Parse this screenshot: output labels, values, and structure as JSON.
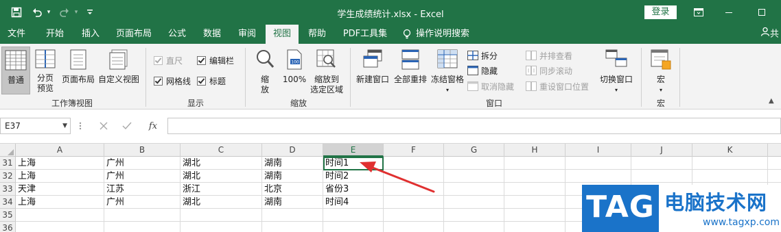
{
  "titlebar": {
    "title": "学生成绩统计.xlsx  -  Excel",
    "login_label": "登录",
    "bg_color": "#217346"
  },
  "tabs": [
    {
      "label": "文件"
    },
    {
      "label": "开始"
    },
    {
      "label": "插入"
    },
    {
      "label": "页面布局"
    },
    {
      "label": "公式"
    },
    {
      "label": "数据"
    },
    {
      "label": "审阅"
    },
    {
      "label": "视图"
    },
    {
      "label": "帮助"
    },
    {
      "label": "PDF工具集"
    },
    {
      "label": "操作说明搜索"
    }
  ],
  "active_tab": "视图",
  "tab_share_fragment": "共",
  "ribbon": {
    "workbook_views": {
      "group_label": "工作簿视图",
      "normal": "普通",
      "page_break_line1": "分页",
      "page_break_line2": "预览",
      "page_layout": "页面布局",
      "custom_view": "自定义视图"
    },
    "show": {
      "group_label": "显示",
      "ruler": "直尺",
      "formula_bar": "编辑栏",
      "gridlines": "网格线",
      "headings": "标题"
    },
    "zoom": {
      "group_label": "缩放",
      "zoom_line1": "缩",
      "zoom_line2": "放",
      "hundred": "100%",
      "zoom_sel_line1": "缩放到",
      "zoom_sel_line2": "选定区域"
    },
    "window": {
      "group_label": "窗口",
      "new_window": "新建窗口",
      "arrange_all": "全部重排",
      "freeze_panes": "冻结窗格",
      "split": "拆分",
      "hide": "隐藏",
      "unhide": "取消隐藏",
      "side_by_side": "并排查看",
      "sync_scroll": "同步滚动",
      "reset_position": "重设窗口位置",
      "switch_line1": "切换窗口"
    },
    "macros": {
      "group_label": "宏",
      "macro": "宏"
    }
  },
  "formula_bar": {
    "name_box": "E37",
    "fx_label": "fx",
    "content": ""
  },
  "columns": [
    "A",
    "B",
    "C",
    "D",
    "E",
    "F",
    "G",
    "H",
    "I",
    "J",
    "K"
  ],
  "rows": [
    {
      "num": "31",
      "cells": [
        "上海",
        "广州",
        "湖北",
        "湖南",
        "时间1"
      ]
    },
    {
      "num": "32",
      "cells": [
        "上海",
        "广州",
        "湖北",
        "湖南",
        "时间2"
      ]
    },
    {
      "num": "33",
      "cells": [
        "天津",
        "江苏",
        "浙江",
        "北京",
        "省份3"
      ]
    },
    {
      "num": "34",
      "cells": [
        "上海",
        "广州",
        "湖北",
        "湖南",
        "时间4"
      ]
    },
    {
      "num": "35",
      "cells": [
        "",
        "",
        "",
        "",
        ""
      ]
    },
    {
      "num": "36",
      "cells": [
        "",
        "",
        "",
        "",
        ""
      ]
    }
  ],
  "watermark": {
    "tag": "TAG",
    "site_name": "电脑技术网",
    "url": "www.tagxp.com"
  },
  "colors": {
    "excel_green": "#217346",
    "arrow_red": "#e03030",
    "watermark_blue": "#1a73c9"
  }
}
